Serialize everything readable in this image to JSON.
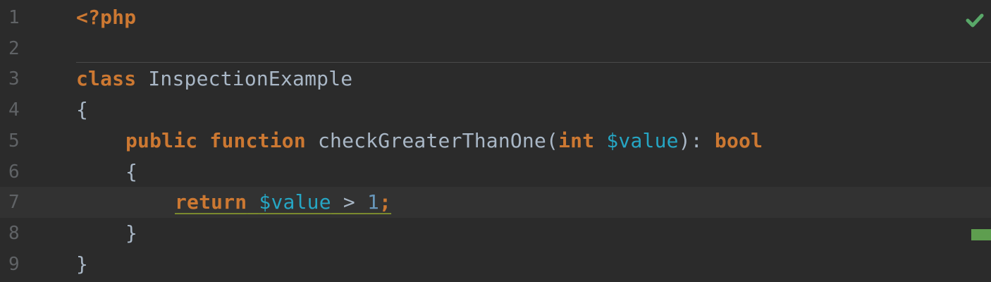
{
  "editor": {
    "status": {
      "icon": "checkmark-icon",
      "color": "#59a869"
    },
    "marker_color": "#5e9e4f",
    "lines": [
      {
        "number": "1",
        "tokens": [
          "<?php"
        ]
      },
      {
        "number": "2",
        "tokens": []
      },
      {
        "number": "3",
        "tokens": [
          "class",
          " ",
          "InspectionExample"
        ]
      },
      {
        "number": "4",
        "tokens": [
          "{"
        ]
      },
      {
        "number": "5",
        "tokens": [
          "public",
          " ",
          "function",
          " ",
          "checkGreaterThanOne",
          "(",
          "int",
          " ",
          "$value",
          "): ",
          "bool"
        ]
      },
      {
        "number": "6",
        "tokens": [
          "{"
        ]
      },
      {
        "number": "7",
        "tokens": [
          "return",
          " ",
          "$value",
          " > ",
          "1",
          ";"
        ]
      },
      {
        "number": "8",
        "tokens": [
          "}"
        ]
      },
      {
        "number": "9",
        "tokens": [
          "}"
        ]
      }
    ]
  }
}
